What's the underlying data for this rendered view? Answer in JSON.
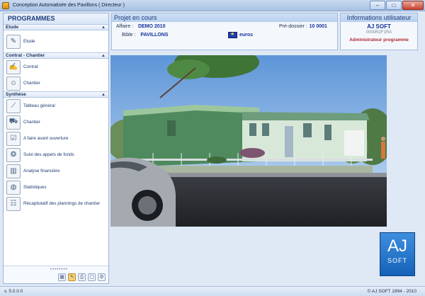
{
  "window": {
    "title": "Conception Automatisée des Pavillons ( Directeur )",
    "buttons": {
      "minimize": "–",
      "maximize": "□",
      "close": "✕"
    }
  },
  "sidebar": {
    "header": "PROGRAMMES",
    "groups": [
      {
        "label": "Etude",
        "items": [
          {
            "label": "Etude",
            "icon": "pencil-ruler-icon"
          }
        ]
      },
      {
        "label": "Contrat - Chantier",
        "items": [
          {
            "label": "Contrat",
            "icon": "contract-icon"
          },
          {
            "label": "Chantier",
            "icon": "worker-icon"
          }
        ]
      },
      {
        "label": "Synthèse",
        "items": [
          {
            "label": "Tableau général",
            "icon": "chart-icon"
          },
          {
            "label": "Chantier",
            "icon": "forklift-icon"
          },
          {
            "label": "A faire avant ouverture",
            "icon": "checklist-icon"
          },
          {
            "label": "Suivi des appels de fonds",
            "icon": "coins-icon"
          },
          {
            "label": "Analyse financière",
            "icon": "bar-chart-icon"
          },
          {
            "label": "Statistiques",
            "icon": "globe-icon"
          },
          {
            "label": "Récapitulatif des plannings de chantier",
            "icon": "planning-icon"
          }
        ]
      }
    ],
    "footer_grip": "••••••••",
    "footer_tools": [
      "▦",
      "✎",
      "⎙",
      "▢",
      "⚙"
    ]
  },
  "project": {
    "title": "Projet en cours",
    "affaire_label": "Affaire :",
    "affaire_value": "DEMO 2010",
    "bible_label": "Bible :",
    "bible_value": "PAVILLONS",
    "dossier_label": "Pré-dossier :",
    "dossier_value": "10 0001",
    "currency": "euros"
  },
  "user": {
    "title": "Informations utilisateur",
    "name": "AJ SOFT",
    "code": "0000R2F1RA",
    "role": "Administrateur programme"
  },
  "logo": {
    "line1": "AJ",
    "line2": "SOFT"
  },
  "status": {
    "version": "v. 5.0.0.0",
    "copyright": "© AJ SOFT 1994 - 2010"
  },
  "colors": {
    "accent": "#1b3a78",
    "brand": "#1462b8",
    "role": "#b5262f"
  }
}
